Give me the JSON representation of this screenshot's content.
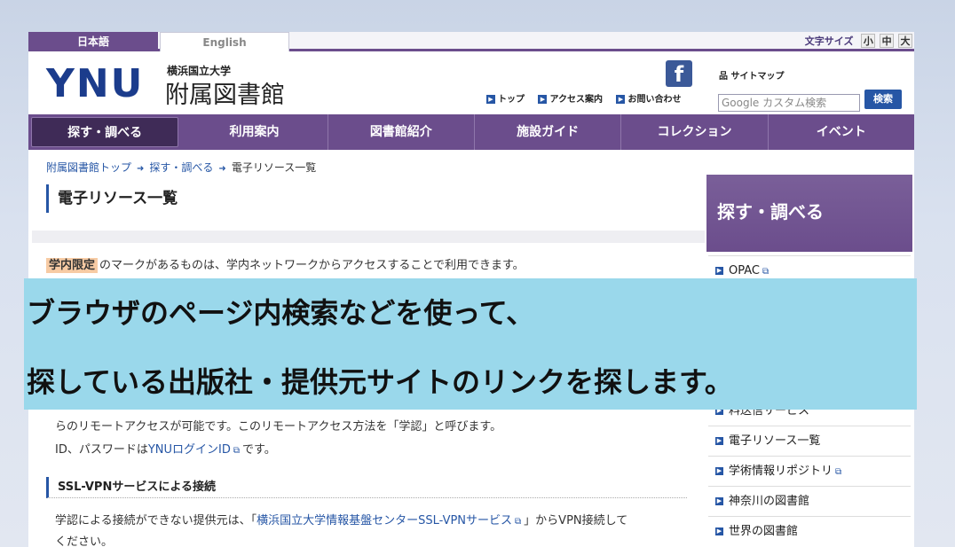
{
  "lang": {
    "japanese": "日本語",
    "english": "English"
  },
  "text_size": {
    "label": "文字サイズ",
    "small": "小",
    "medium": "中",
    "large": "大"
  },
  "header": {
    "logo_ynu": "YNU",
    "logo_sub": "横浜国立大学",
    "logo_main": "附属図書館",
    "facebook": "f",
    "links": [
      "トップ",
      "アクセス案内",
      "お問い合わせ"
    ],
    "sitemap": "サイトマップ",
    "search_placeholder": "Google カスタム検索",
    "search_button": "検索"
  },
  "nav": [
    "探す・調べる",
    "利用案内",
    "図書館紹介",
    "施設ガイド",
    "コレクション",
    "イベント"
  ],
  "breadcrumb": {
    "home": "附属図書館トップ",
    "parent": "探す・調べる",
    "current": "電子リソース一覧"
  },
  "page_title": "電子リソース一覧",
  "notice": {
    "badge": "学内限定",
    "text": "のマークがあるものは、学内ネットワークからアクセスすることで利用できます。"
  },
  "body": {
    "line1": "らのリモートアクセスが可能です。このリモートアクセス方法を「学認」と呼びます。",
    "line2_pre": "ID、パスワードは",
    "line2_link": "YNUログインID",
    "line2_post": "です。",
    "subheading": "SSL-VPNサービスによる接続",
    "line3_pre": "学認による接続ができない提供元は、「",
    "line3_link": "横浜国立大学情報基盤センターSSL-VPNサービス",
    "line3_post": "」からVPN接続して",
    "line4": "ください。"
  },
  "sidebar": {
    "title": "探す・調べる",
    "items": [
      "OPAC",
      "料送信サービス",
      "電子リソース一覧",
      "学術情報リポジトリ",
      "神奈川の図書館",
      "世界の図書館"
    ]
  },
  "overlay": {
    "line1": "ブラウザのページ内検索などを使って、",
    "line2": "探している出版社・提供元サイトのリンクを探します。"
  }
}
